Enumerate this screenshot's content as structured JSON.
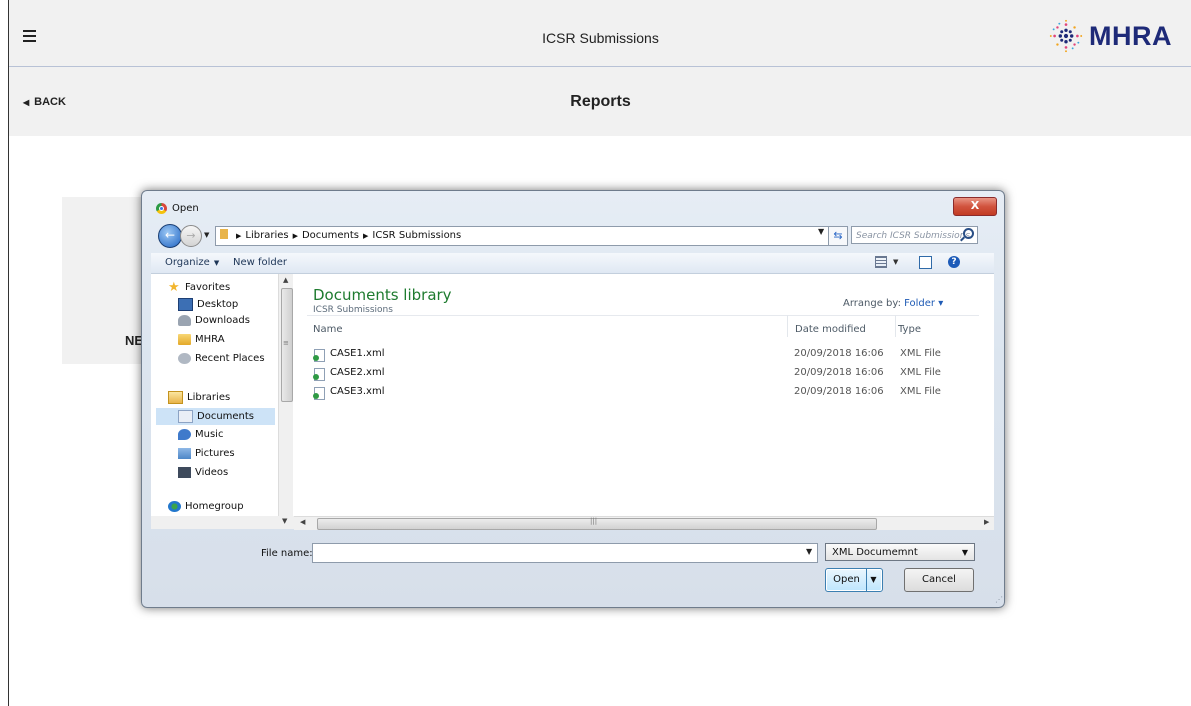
{
  "header": {
    "app_title": "ICSR Submissions",
    "logo_text": "MHRA"
  },
  "subheader": {
    "back_label": "BACK",
    "page_title": "Reports"
  },
  "background_card": {
    "text": "NE"
  },
  "dialog": {
    "title": "Open",
    "close_label": "X",
    "breadcrumb": [
      "Libraries",
      "Documents",
      "ICSR Submissions"
    ],
    "search_placeholder": "Search ICSR Submissions",
    "toolbar": {
      "organize_label": "Organize",
      "new_folder_label": "New folder"
    },
    "nav": {
      "favorites": "Favorites",
      "desktop": "Desktop",
      "downloads": "Downloads",
      "mhra": "MHRA",
      "recent_places": "Recent Places",
      "libraries": "Libraries",
      "documents": "Documents",
      "music": "Music",
      "pictures": "Pictures",
      "videos": "Videos",
      "homegroup": "Homegroup"
    },
    "library_title": "Documents library",
    "library_subtitle": "ICSR Submissions",
    "arrange_label": "Arrange by:",
    "arrange_value": "Folder",
    "columns": {
      "name": "Name",
      "date_modified": "Date modified",
      "type": "Type"
    },
    "files": [
      {
        "name": "CASE1.xml",
        "date": "20/09/2018 16:06",
        "type": "XML File"
      },
      {
        "name": "CASE2.xml",
        "date": "20/09/2018 16:06",
        "type": "XML File"
      },
      {
        "name": "CASE3.xml",
        "date": "20/09/2018 16:06",
        "type": "XML File"
      }
    ],
    "file_name_label": "File name:",
    "file_name_value": "",
    "file_type": "XML Documemnt",
    "open_label": "Open",
    "cancel_label": "Cancel"
  },
  "colors": {
    "logo_blue": "#1e2a78",
    "library_green": "#1e7b2f",
    "link_blue": "#1f5bb5"
  }
}
